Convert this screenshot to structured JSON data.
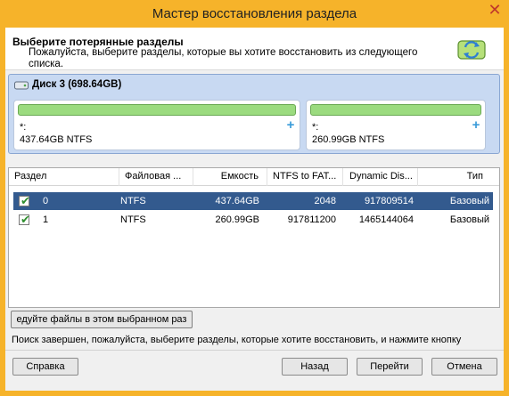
{
  "window": {
    "title": "Мастер восстановления раздела"
  },
  "header": {
    "title": "Выберите потерянные разделы",
    "subtitle": "Пожалуйста, выберите разделы, которые вы хотите восстановить из следующего списка."
  },
  "disk": {
    "label": "Диск 3 (698.64GB)",
    "partitions": [
      {
        "name": "*:",
        "info": "437.64GB NTFS",
        "fill": 1.0
      },
      {
        "name": "*:",
        "info": "260.99GB NTFS",
        "fill": 1.0
      }
    ]
  },
  "table": {
    "columns": [
      "Раздел",
      "Файловая ...",
      "Емкость",
      "NTFS to FAT...",
      "Dynamic Dis...",
      "Тип"
    ],
    "rows": [
      {
        "checked": true,
        "selected": true,
        "cells": [
          "0",
          "NTFS",
          "437.64GB",
          "2048",
          "917809514",
          "Базовый"
        ]
      },
      {
        "checked": true,
        "selected": false,
        "cells": [
          "1",
          "NTFS",
          "260.99GB",
          "917811200",
          "1465144064",
          "Базовый"
        ]
      }
    ]
  },
  "browse_button": "едуйте файлы в этом выбранном раз",
  "status_text": "Поиск завершен, пожалуйста, выберите разделы, которые хотите восстановить, и нажмите кнопку",
  "buttons": {
    "help": "Справка",
    "back": "Назад",
    "go": "Перейти",
    "cancel": "Отмена"
  },
  "colors": {
    "titlebar": "#f6b32a",
    "selection": "#335a8e",
    "partition_fill": "#9bdb7f",
    "disk_panel": "#c8d9f2"
  },
  "icons": {
    "close": "close-icon",
    "header": "partition-recovery-icon",
    "disk": "disk-icon",
    "add": "plus-icon",
    "check": "checkbox-icon"
  }
}
